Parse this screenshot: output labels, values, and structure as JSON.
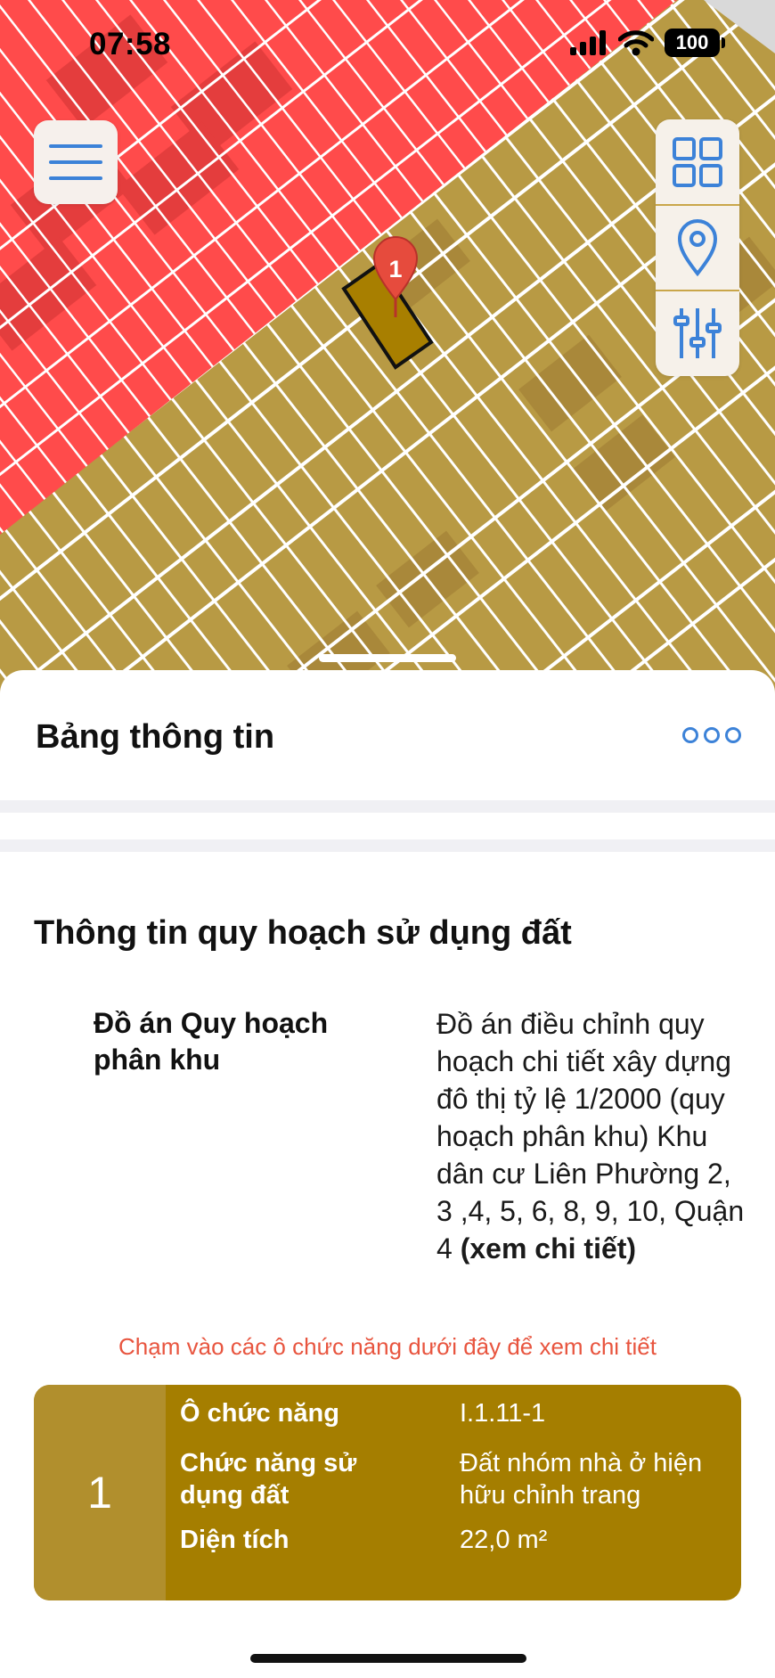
{
  "status_bar": {
    "time": "07:58",
    "battery": "100"
  },
  "map": {
    "marker_label": "1",
    "colors": {
      "zone_red": "#ff4b4b",
      "zone_gold": "#b89a44",
      "parcel_selected": "#a87f00"
    }
  },
  "toolbar": {
    "menu_icon": "hamburger-menu-icon",
    "buttons": [
      "grid-layers-icon",
      "location-pin-icon",
      "filter-sliders-icon"
    ]
  },
  "sheet": {
    "title": "Bảng thông tin",
    "more_icon": "more-dots-icon"
  },
  "planning": {
    "section_title": "Thông tin quy hoạch sử dụng đất",
    "label": "Đồ án Quy hoạch phân khu",
    "value_text": "Đồ án điều chỉnh quy hoạch chi tiết xây dựng đô thị tỷ lệ 1/2000 (quy hoạch phân khu) Khu dân cư Liên Phường 2, 3 ,4, 5, 6, 8, 9, 10, Quận 4 ",
    "value_link": "(xem chi tiết)"
  },
  "hint": "Chạm vào các ô chức năng dưới đây để xem chi tiết",
  "function_card": {
    "index": "1",
    "rows": [
      {
        "label": "Ô chức năng",
        "value": "I.1.11-1"
      },
      {
        "label": "Chức năng sử dụng đất",
        "value": "Đất nhóm nhà ở hiện hữu chỉnh trang"
      },
      {
        "label": "Diện tích",
        "value": "22,0 m²"
      }
    ],
    "colors": {
      "index_bg": "#b18f2d",
      "card_bg": "#a57e00"
    }
  }
}
